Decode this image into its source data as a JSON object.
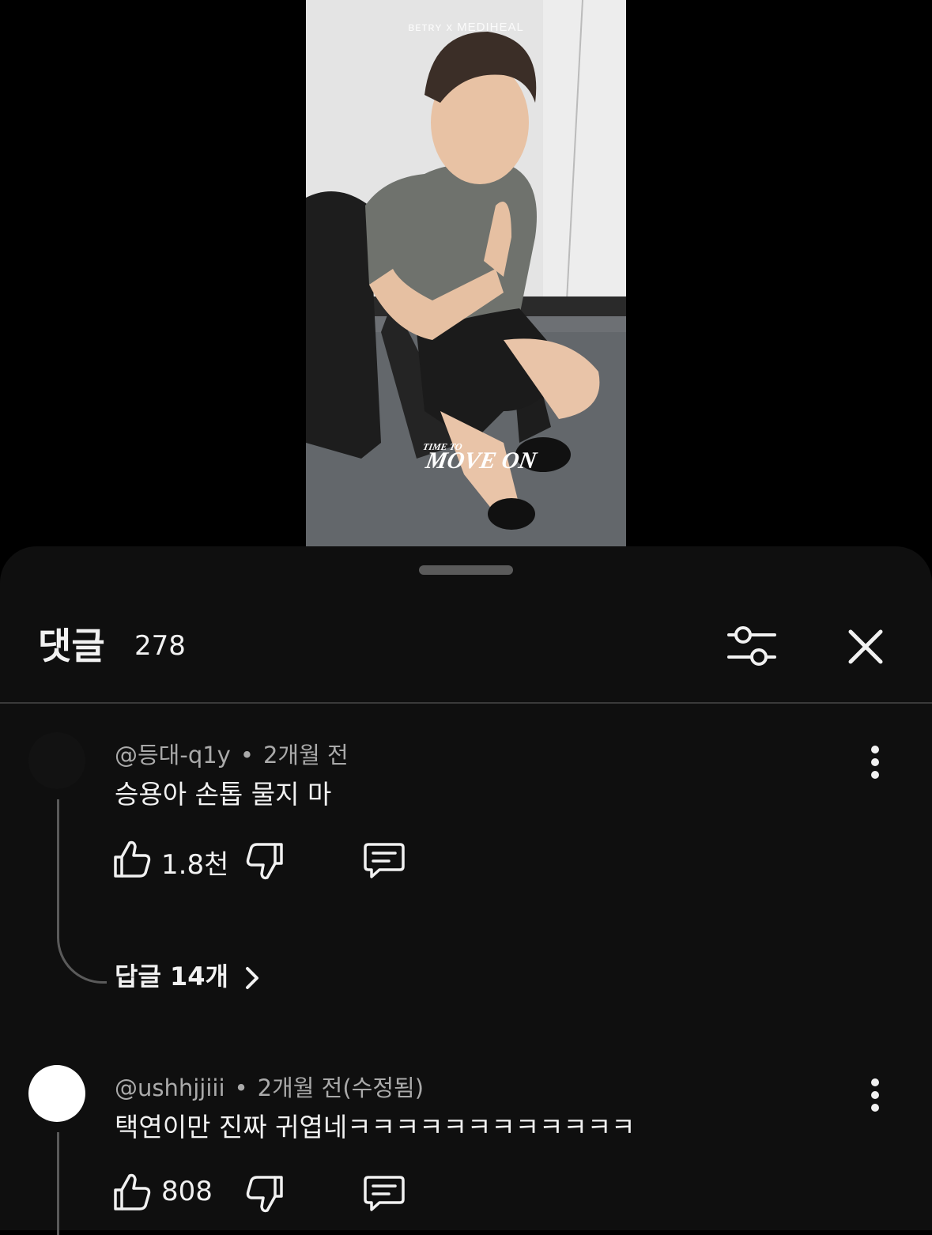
{
  "video": {
    "watermark": "ʙᴇᴛʀʏ x MEDIHEAL",
    "overlay_small": "TIME TO",
    "overlay_big": "MOVE ON"
  },
  "comments_panel": {
    "title": "댓글",
    "count": "278",
    "comments": [
      {
        "author": "@등대-q1y",
        "time": "2개월 전",
        "text": "승용아 손톱 물지 마",
        "likes": "1.8천",
        "replies_label": "답글 14개"
      },
      {
        "author": "@ushhjjiii",
        "time": "2개월 전(수정됨)",
        "text": "택연이만 진짜 귀엽네ㅋㅋㅋㅋㅋㅋㅋㅋㅋㅋㅋㅋ",
        "likes": "808"
      }
    ]
  },
  "colors": {
    "sheet_bg": "#0f0f0f",
    "text_primary": "#f1f1f1",
    "text_secondary": "#aaaaaa",
    "divider": "#3a3a3a"
  }
}
